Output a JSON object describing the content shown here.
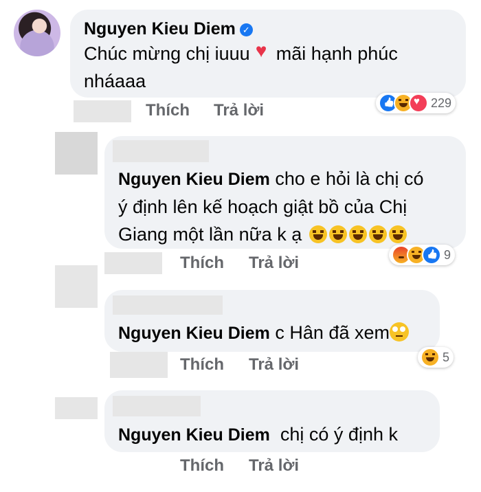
{
  "comment": {
    "author": "Nguyen Kieu Diem",
    "text_line1_a": "Chúc mừng chị iuuu",
    "text_line1_b": "mãi hạnh phúc",
    "text_line2": "nháaaa",
    "like_label": "Thích",
    "reply_label": "Trả lời",
    "reaction_count": "229",
    "reactions": [
      "like-icon",
      "haha-icon",
      "love-icon"
    ]
  },
  "replies": [
    {
      "mention": "Nguyen Kieu Diem",
      "text_line1": "cho e hỏi là chị có",
      "text_line2": "ý định lên kế hoạch giật bồ của Chị",
      "text_line3": "Giang một lần nữa k ạ",
      "like_label": "Thích",
      "reply_label": "Trả lời",
      "reaction_count": "9",
      "reactions": [
        "angry-icon",
        "haha-icon",
        "like-icon"
      ]
    },
    {
      "mention": "Nguyen Kieu Diem",
      "text": "c Hân đã xem",
      "like_label": "Thích",
      "reply_label": "Trả lời",
      "reaction_count": "5",
      "reactions": [
        "haha-icon"
      ]
    },
    {
      "mention": "Nguyen Kieu Diem",
      "text": "chị có ý định k",
      "like_label": "Thích",
      "reply_label": "Trả lời"
    }
  ],
  "colors": {
    "bubble": "#f0f2f5",
    "action_text": "#65676b",
    "like_blue": "#1877f2",
    "love_red": "#f33e58"
  }
}
